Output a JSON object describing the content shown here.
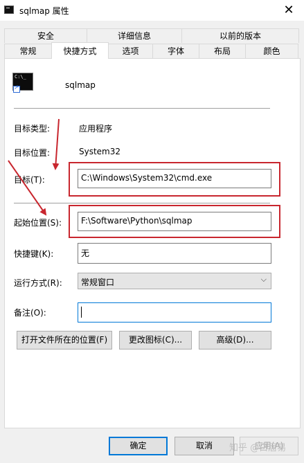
{
  "window": {
    "title": "sqlmap 属性",
    "close_symbol": "✕"
  },
  "tabs": {
    "row1": [
      "安全",
      "详细信息",
      "以前的版本"
    ],
    "row2": [
      "常规",
      "快捷方式",
      "选项",
      "字体",
      "布局",
      "颜色"
    ],
    "active": "快捷方式"
  },
  "shortcut": {
    "name": "sqlmap",
    "target_type_label": "目标类型:",
    "target_type_value": "应用程序",
    "target_location_label": "目标位置:",
    "target_location_value": "System32",
    "target_label": "目标(T):",
    "target_value": "C:\\Windows\\System32\\cmd.exe",
    "start_in_label": "起始位置(S):",
    "start_in_value": "F:\\Software\\Python\\sqlmap",
    "hotkey_label": "快捷键(K):",
    "hotkey_value": "无",
    "run_label": "运行方式(R):",
    "run_value": "常规窗口",
    "comment_label": "备注(O):",
    "comment_value": ""
  },
  "buttons": {
    "open_location": "打开文件所在的位置(F)",
    "change_icon": "更改图标(C)...",
    "advanced": "高级(D)...",
    "ok": "确定",
    "cancel": "取消",
    "apply": "应用(A)"
  },
  "watermark": "知乎 @白居易",
  "colors": {
    "annotation_red": "#c8262e",
    "focus_blue": "#0078d7"
  },
  "icons": {
    "window": "console-icon",
    "shortcut": "cmd-shortcut-icon",
    "dropdown": "chevron-down-icon"
  }
}
